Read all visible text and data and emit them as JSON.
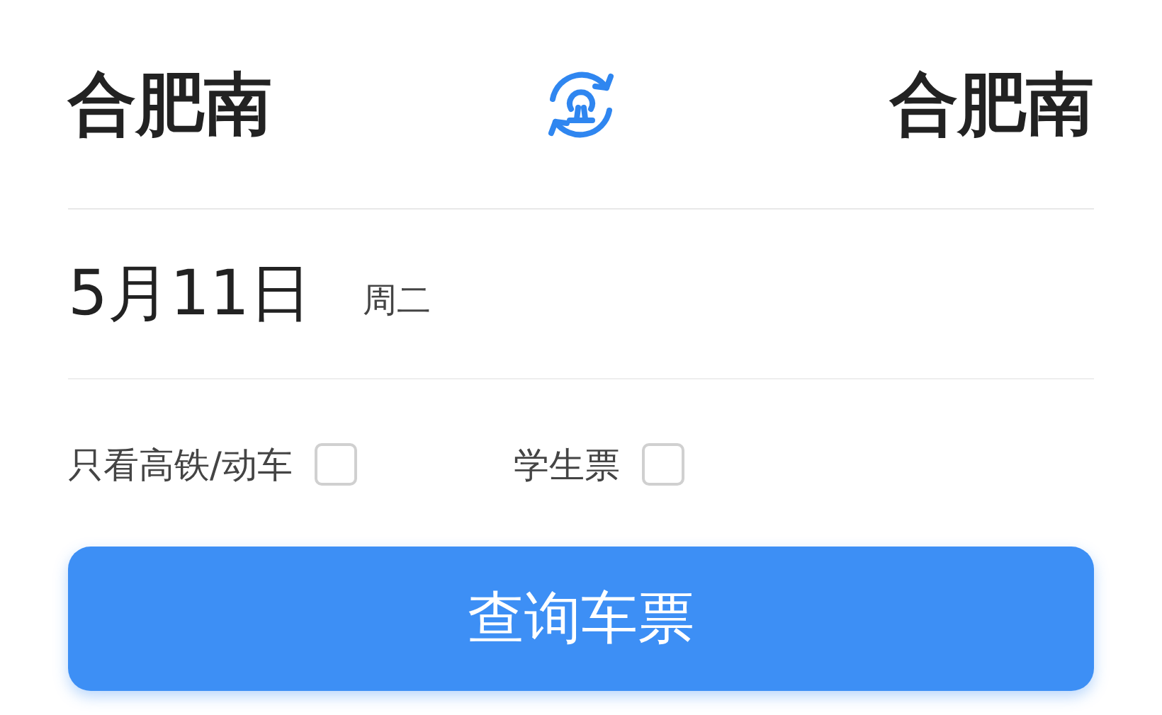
{
  "route": {
    "from": "合肥南",
    "to": "合肥南"
  },
  "date": {
    "day": "5月11日",
    "weekday": "周二"
  },
  "options": [
    {
      "label": "只看高铁/动车",
      "checked": false
    },
    {
      "label": "学生票",
      "checked": false
    }
  ],
  "search_button": "查询车票"
}
